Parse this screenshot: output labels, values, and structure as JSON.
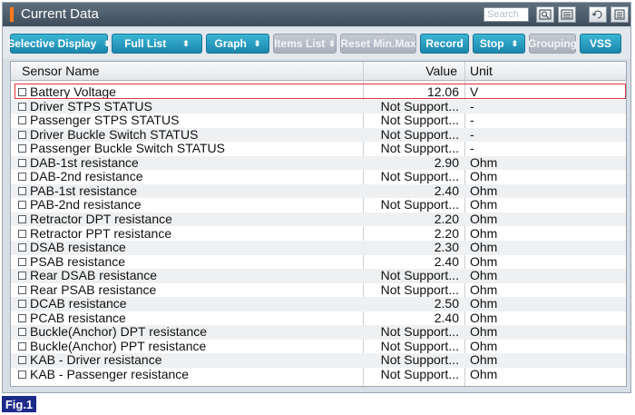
{
  "window": {
    "title": "Current Data",
    "search_placeholder": "Search"
  },
  "toolbar": {
    "buttons": [
      {
        "label": "Selective Display",
        "dropdown": true,
        "enabled": true
      },
      {
        "label": "Full List",
        "dropdown": true,
        "enabled": true
      },
      {
        "label": "Graph",
        "dropdown": true,
        "enabled": true
      },
      {
        "label": "Items List",
        "dropdown": true,
        "enabled": false
      },
      {
        "label": "Reset Min.Max",
        "dropdown": false,
        "enabled": false
      },
      {
        "label": "Record",
        "dropdown": false,
        "enabled": true
      },
      {
        "label": "Stop",
        "dropdown": true,
        "enabled": true
      },
      {
        "label": "Grouping",
        "dropdown": false,
        "enabled": false
      },
      {
        "label": "VSS",
        "dropdown": false,
        "enabled": true
      }
    ]
  },
  "table": {
    "headers": {
      "name": "Sensor Name",
      "value": "Value",
      "unit": "Unit"
    },
    "rows": [
      {
        "name": "Battery Voltage",
        "value": "12.06",
        "unit": "V"
      },
      {
        "name": "Driver STPS STATUS",
        "value": "Not Support...",
        "unit": "-"
      },
      {
        "name": "Passenger STPS STATUS",
        "value": "Not Support...",
        "unit": "-"
      },
      {
        "name": "Driver Buckle Switch STATUS",
        "value": "Not Support...",
        "unit": "-"
      },
      {
        "name": "Passenger Buckle Switch STATUS",
        "value": "Not Support...",
        "unit": "-"
      },
      {
        "name": "DAB-1st resistance",
        "value": "2.90",
        "unit": "Ohm"
      },
      {
        "name": "DAB-2nd resistance",
        "value": "Not Support...",
        "unit": "Ohm"
      },
      {
        "name": "PAB-1st resistance",
        "value": "2.40",
        "unit": "Ohm"
      },
      {
        "name": "PAB-2nd resistance",
        "value": "Not Support...",
        "unit": "Ohm"
      },
      {
        "name": "Retractor DPT resistance",
        "value": "2.20",
        "unit": "Ohm"
      },
      {
        "name": "Retractor PPT resistance",
        "value": "2.20",
        "unit": "Ohm"
      },
      {
        "name": "DSAB resistance",
        "value": "2.30",
        "unit": "Ohm"
      },
      {
        "name": "PSAB resistance",
        "value": "2.40",
        "unit": "Ohm"
      },
      {
        "name": "Rear DSAB resistance",
        "value": "Not Support...",
        "unit": "Ohm"
      },
      {
        "name": "Rear PSAB resistance",
        "value": "Not Support...",
        "unit": "Ohm"
      },
      {
        "name": "DCAB resistance",
        "value": "2.50",
        "unit": "Ohm"
      },
      {
        "name": "PCAB resistance",
        "value": "2.40",
        "unit": "Ohm"
      },
      {
        "name": "Buckle(Anchor) DPT resistance",
        "value": "Not Support...",
        "unit": "Ohm"
      },
      {
        "name": "Buckle(Anchor) PPT resistance",
        "value": "Not Support...",
        "unit": "Ohm"
      },
      {
        "name": "KAB - Driver resistance",
        "value": "Not Support...",
        "unit": "Ohm"
      },
      {
        "name": "KAB - Passenger resistance",
        "value": "Not Support...",
        "unit": "Ohm"
      }
    ],
    "selected_row": 0
  },
  "figure_label": "Fig.1",
  "icons": [
    "search-icon",
    "list-icon",
    "retry-icon",
    "menu-icon"
  ],
  "colors": {
    "accent": "#1a86ad",
    "highlight": "#e0343b",
    "title_marker": "#ff7a1a",
    "fig_label": "#1c2a8a"
  }
}
